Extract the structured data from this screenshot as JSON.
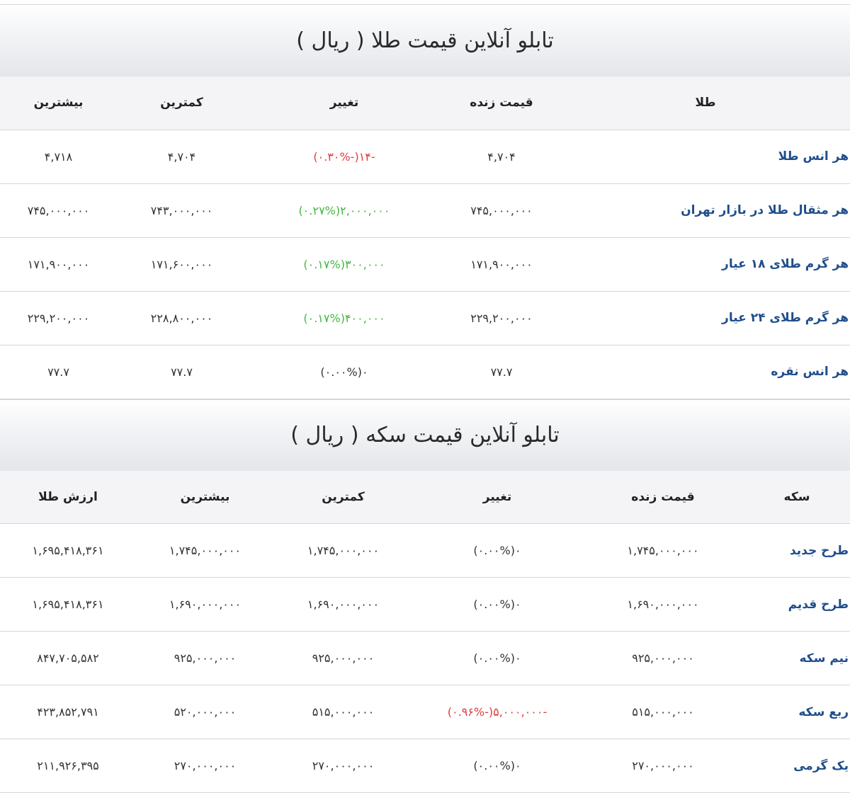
{
  "gold_board": {
    "title": "تابلو آنلاین قیمت طلا ( ریال )",
    "headers": [
      "طلا",
      "قیمت زنده",
      "تغییر",
      "کمترین",
      "بیشترین"
    ],
    "rows": [
      {
        "name": "هر انس طلا",
        "price": "۴,۷۰۴",
        "change": "-۱۴(-۰.۳۰%)",
        "change_dir": "neg",
        "min": "۴,۷۰۴",
        "max": "۴,۷۱۸"
      },
      {
        "name": "هر مثقال طلا در بازار تهران",
        "price": "۷۴۵,۰۰۰,۰۰۰",
        "change": "۲,۰۰۰,۰۰۰(۰.۲۷%)",
        "change_dir": "pos",
        "min": "۷۴۳,۰۰۰,۰۰۰",
        "max": "۷۴۵,۰۰۰,۰۰۰"
      },
      {
        "name": "هر گرم طلای ۱۸ عیار",
        "price": "۱۷۱,۹۰۰,۰۰۰",
        "change": "۳۰۰,۰۰۰(۰.۱۷%)",
        "change_dir": "pos",
        "min": "۱۷۱,۶۰۰,۰۰۰",
        "max": "۱۷۱,۹۰۰,۰۰۰"
      },
      {
        "name": "هر گرم طلای ۲۴ عیار",
        "price": "۲۲۹,۲۰۰,۰۰۰",
        "change": "۴۰۰,۰۰۰(۰.۱۷%)",
        "change_dir": "pos",
        "min": "۲۲۸,۸۰۰,۰۰۰",
        "max": "۲۲۹,۲۰۰,۰۰۰"
      },
      {
        "name": "هر انس نقره",
        "price": "۷۷.۷",
        "change": "۰(۰.۰۰%)",
        "change_dir": "zero",
        "min": "۷۷.۷",
        "max": "۷۷.۷"
      }
    ]
  },
  "coin_board": {
    "title": "تابلو آنلاین قیمت سکه ( ریال )",
    "headers": [
      "سکه",
      "قیمت زنده",
      "تغییر",
      "کمترین",
      "بیشترین",
      "ارزش طلا"
    ],
    "rows": [
      {
        "name": "طرح جدید",
        "price": "۱,۷۴۵,۰۰۰,۰۰۰",
        "change": "۰(۰.۰۰%)",
        "change_dir": "zero",
        "min": "۱,۷۴۵,۰۰۰,۰۰۰",
        "max": "۱,۷۴۵,۰۰۰,۰۰۰",
        "gold_value": "۱,۶۹۵,۴۱۸,۳۶۱"
      },
      {
        "name": "طرح قدیم",
        "price": "۱,۶۹۰,۰۰۰,۰۰۰",
        "change": "۰(۰.۰۰%)",
        "change_dir": "zero",
        "min": "۱,۶۹۰,۰۰۰,۰۰۰",
        "max": "۱,۶۹۰,۰۰۰,۰۰۰",
        "gold_value": "۱,۶۹۵,۴۱۸,۳۶۱"
      },
      {
        "name": "نیم سکه",
        "price": "۹۲۵,۰۰۰,۰۰۰",
        "change": "۰(۰.۰۰%)",
        "change_dir": "zero",
        "min": "۹۲۵,۰۰۰,۰۰۰",
        "max": "۹۲۵,۰۰۰,۰۰۰",
        "gold_value": "۸۴۷,۷۰۵,۵۸۲"
      },
      {
        "name": "ربع سکه",
        "price": "۵۱۵,۰۰۰,۰۰۰",
        "change": "-۵,۰۰۰,۰۰۰(-۰.۹۶%)",
        "change_dir": "neg",
        "min": "۵۱۵,۰۰۰,۰۰۰",
        "max": "۵۲۰,۰۰۰,۰۰۰",
        "gold_value": "۴۲۳,۸۵۲,۷۹۱"
      },
      {
        "name": "یک گرمی",
        "price": "۲۷۰,۰۰۰,۰۰۰",
        "change": "۰(۰.۰۰%)",
        "change_dir": "zero",
        "min": "۲۷۰,۰۰۰,۰۰۰",
        "max": "۲۷۰,۰۰۰,۰۰۰",
        "gold_value": "۲۱۱,۹۲۶,۳۹۵"
      }
    ]
  },
  "colors": {
    "negative": "#e23b3b",
    "positive": "#3fb83f",
    "name_link": "#1f4e8c"
  }
}
